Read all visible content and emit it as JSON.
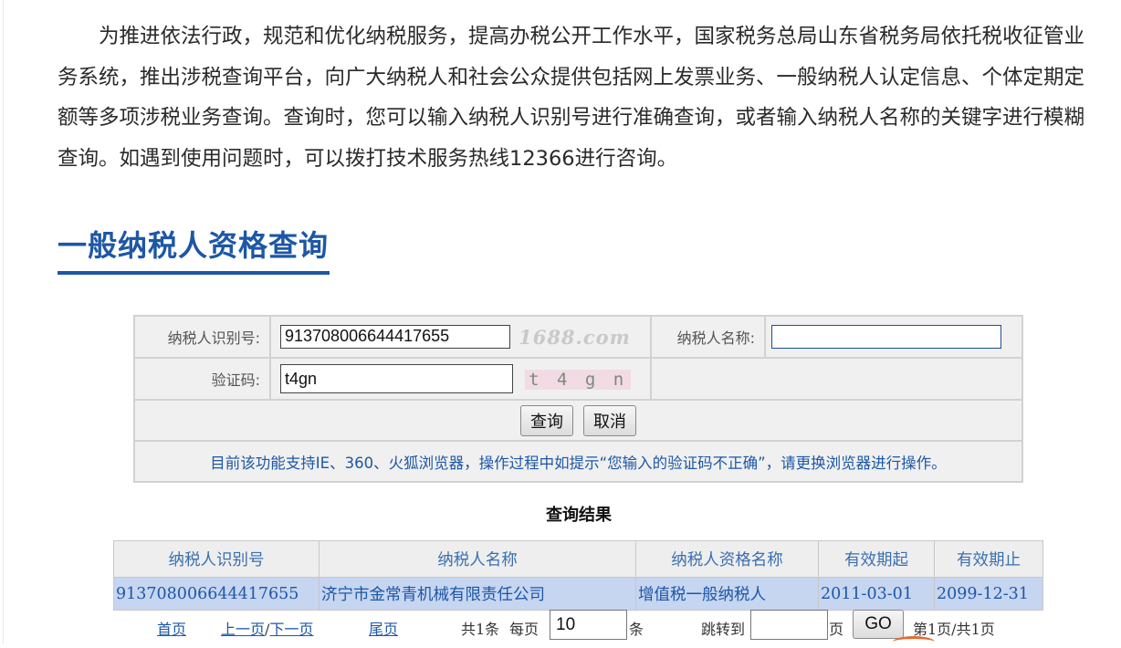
{
  "intro": "为推进依法行政，规范和优化纳税服务，提高办税公开工作水平，国家税务总局山东省税务局依托税收征管业务系统，推出涉税查询平台，向广大纳税人和社会公众提供包括网上发票业务、一般纳税人认定信息、个体定期定额等多项涉税业务查询。查询时，您可以输入纳税人识别号进行准确查询，或者输入纳税人名称的关键字进行模糊查询。如遇到使用问题时，可以拨打技术服务热线12366进行咨询。",
  "section_title": "一般纳税人资格查询",
  "form": {
    "taxid_label": "纳税人识别号:",
    "taxid_value": "913708006644417655",
    "watermark": "1688.com",
    "name_label": "纳税人名称:",
    "name_value": "",
    "captcha_label": "验证码:",
    "captcha_value": "t4gn",
    "captcha_image_text": "t 4 g n",
    "query_button": "查询",
    "cancel_button": "取消",
    "notice": "目前该功能支持IE、360、火狐浏览器，操作过程中如提示“您输入的验证码不正确”，请更换浏览器进行操作。"
  },
  "results": {
    "title": "查询结果",
    "columns": [
      "纳税人识别号",
      "纳税人名称",
      "纳税人资格名称",
      "有效期起",
      "有效期止"
    ],
    "rows": [
      [
        "913708006644417655",
        "济宁市金常青机械有限责任公司",
        "增值税一般纳税人",
        "2011-03-01",
        "2099-12-31"
      ]
    ]
  },
  "pager": {
    "first": "首页",
    "prev": "上一页",
    "sep": "/",
    "next": "下一页",
    "last": "尾页",
    "total": "共1条",
    "per_page_label": "每页",
    "per_page_value": "10",
    "per_page_unit": "条",
    "jump_label": "跳转到",
    "jump_value": "",
    "page_unit": "页",
    "go": "GO",
    "page_info": "第1页/共1页"
  },
  "colors": {
    "accent": "#1d57a6",
    "row_highlight": "#c6d5f0",
    "captcha_bg": "#f2dbe4"
  }
}
